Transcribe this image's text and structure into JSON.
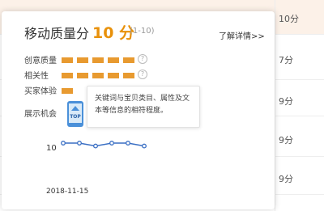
{
  "background_table": {
    "scores": [
      "10分",
      "7分",
      "9分",
      "9分",
      "9分"
    ]
  },
  "card": {
    "title": "移动质量分",
    "score": "10 分",
    "range": "(1-10)",
    "detail_link": "了解详情>>",
    "rows": [
      {
        "label": "创意质量",
        "level": 5
      },
      {
        "label": "相关性",
        "level": 5
      },
      {
        "label": "买家体验"
      },
      {
        "label": "展示机会"
      }
    ],
    "tooltip": "关键词与宝贝类目、属性及文本等信息的相符程度。",
    "phone_badge": "TOP",
    "icons": [
      "help-icon",
      "phone-top-icon"
    ]
  },
  "chart_data": {
    "type": "line",
    "x": [
      "",
      "",
      "",
      "",
      "",
      ""
    ],
    "values": [
      10,
      10,
      9.7,
      10,
      10,
      9.7
    ],
    "y_tick": "10",
    "x_tick": "2018-11-15",
    "color": "#3a6fc4"
  }
}
